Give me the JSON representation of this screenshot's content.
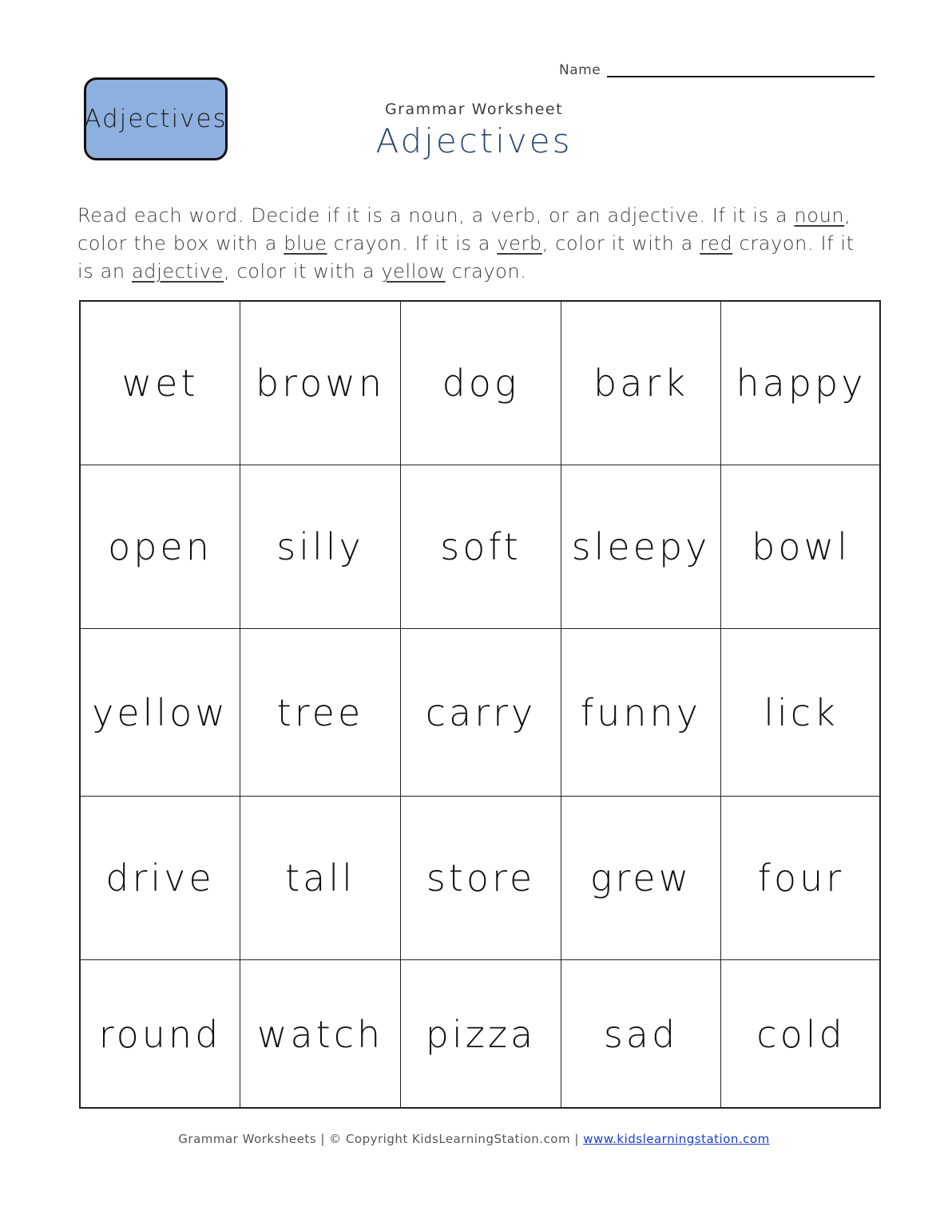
{
  "badge": {
    "label": "Adjectives",
    "color": "#8eb0df"
  },
  "name_field": {
    "label": "Name",
    "value": ""
  },
  "header": {
    "subtitle": "Grammar Worksheet",
    "title": "Adjectives",
    "title_color": "#2f4a6a"
  },
  "instructions": {
    "parts": [
      "Read each word.  Decide if it is a noun, a verb, or an adjective.  If it is a ",
      "noun",
      ", color the box with a ",
      "blue",
      " crayon.  If it is a ",
      "verb",
      ", color it with a ",
      "red",
      " crayon.  If it is an ",
      "adjective",
      ", color it with a ",
      "yellow",
      " crayon."
    ]
  },
  "word_grid": {
    "rows": [
      [
        "wet",
        "brown",
        "dog",
        "bark",
        "happy"
      ],
      [
        "open",
        "silly",
        "soft",
        "sleepy",
        "bowl"
      ],
      [
        "yellow",
        "tree",
        "carry",
        "funny",
        "lick"
      ],
      [
        "drive",
        "tall",
        "store",
        "grew",
        "four"
      ],
      [
        "round",
        "watch",
        "pizza",
        "sad",
        "cold"
      ]
    ]
  },
  "footer": {
    "left": "Grammar Worksheets",
    "separator": " | ",
    "copyright": "© Copyright KidsLearningStation.com",
    "link_text": "www.kidslearningstation.com",
    "link_color": "#1a3ccc"
  }
}
